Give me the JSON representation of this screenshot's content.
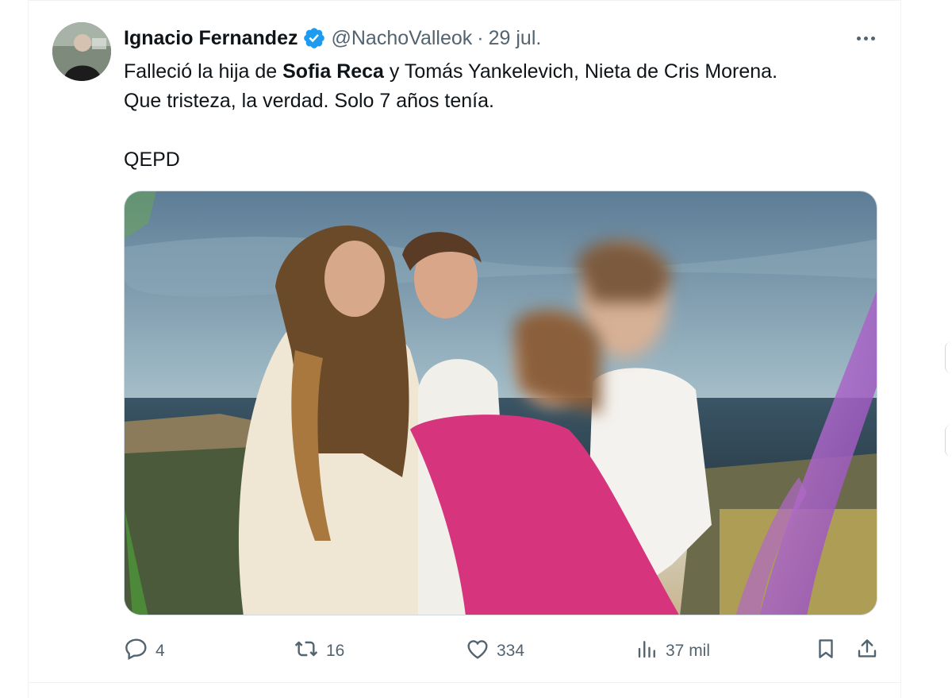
{
  "tweet": {
    "author": {
      "name": "Ignacio Fernandez",
      "handle": "@NachoValleok",
      "verified": true,
      "avatar_icon": "profile-avatar"
    },
    "separator": "·",
    "date": "29 jul.",
    "more_icon": "more-horizontal-icon",
    "text": {
      "line1_pre": "Falleció la hija de ",
      "line1_bold": "Sofia Reca",
      "line1_post": " y Tomás Yankelevich, Nieta de Cris Morena.",
      "line2": "Que tristeza, la verdad. Solo 7 años tenía.",
      "line3": "QEPD"
    },
    "media": {
      "kind": "photo",
      "alt_icon": "family-photo"
    },
    "actions": {
      "replies": "4",
      "retweets": "16",
      "likes": "334",
      "views": "37 mil"
    }
  },
  "colors": {
    "text_primary": "#0f1419",
    "text_secondary": "#536471",
    "verified_blue": "#1d9bf0",
    "border": "#eff3f4"
  }
}
